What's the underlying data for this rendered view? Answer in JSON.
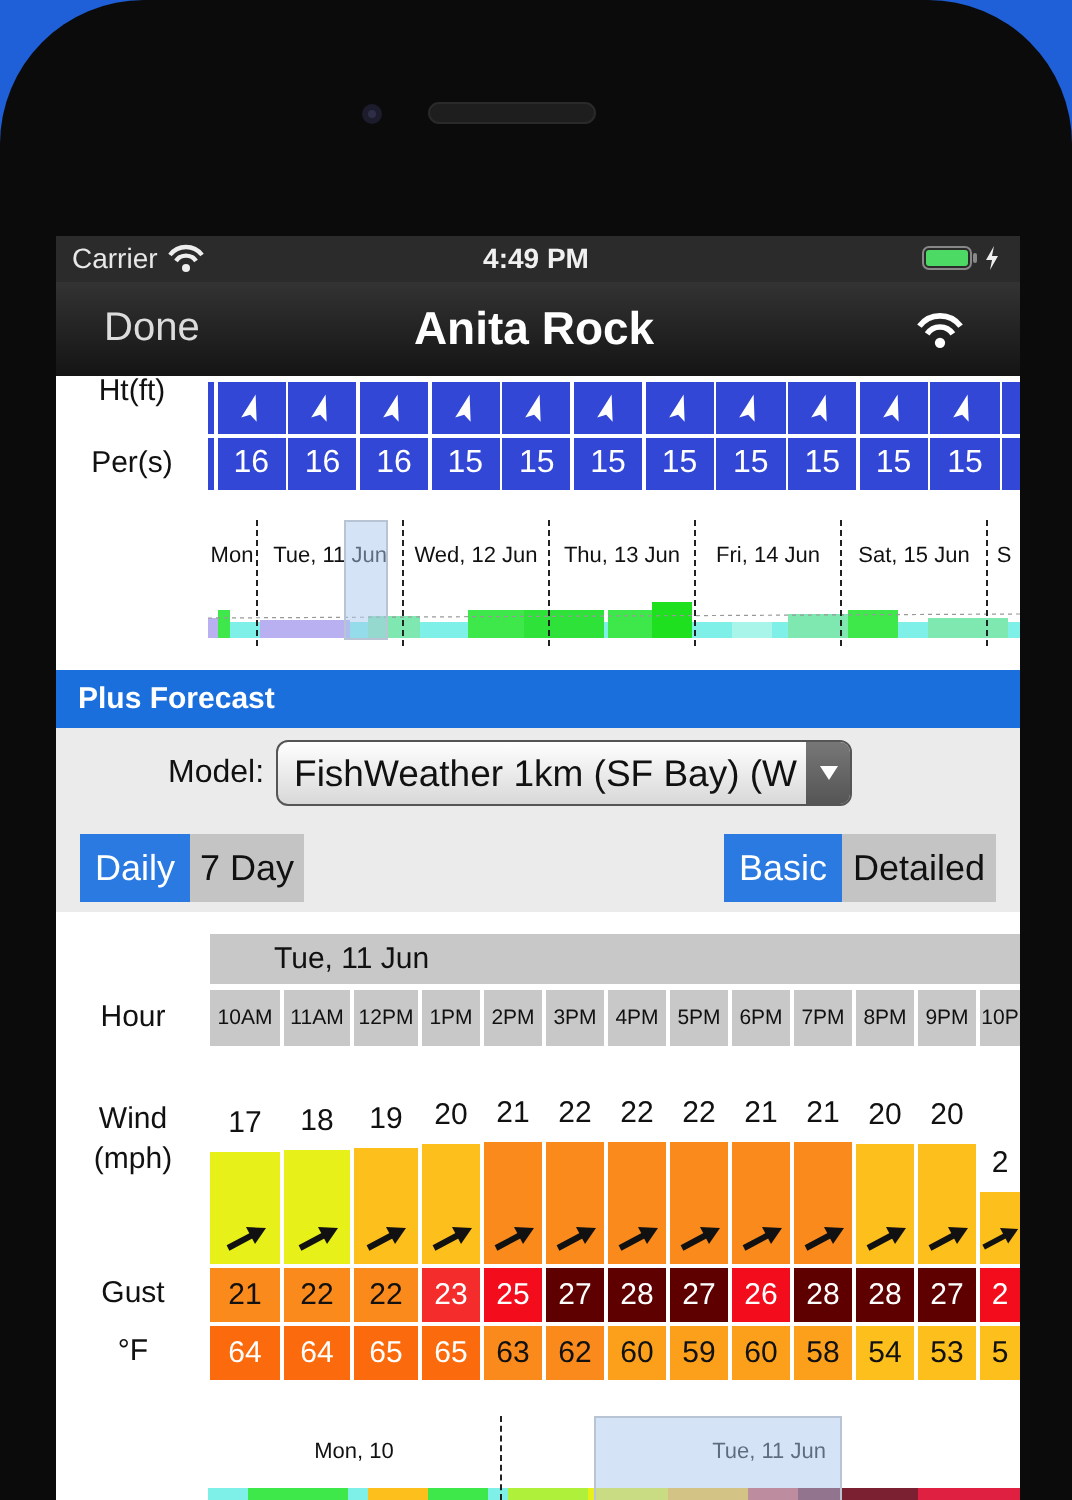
{
  "status_bar": {
    "carrier": "Carrier",
    "time": "4:49 PM"
  },
  "nav": {
    "back": "Done",
    "title": "Anita Rock"
  },
  "swell": {
    "ht_label": "Ht(ft)",
    "per_label": "Per(s)",
    "periods": [
      "16",
      "16",
      "16",
      "15",
      "15",
      "15",
      "15",
      "15",
      "15",
      "15",
      "15"
    ]
  },
  "overview": {
    "days": [
      "Mon",
      "Tue, 11 Jun",
      "Wed, 12 Jun",
      "Thu, 13 Jun",
      "Fri, 14 Jun",
      "Sat, 15 Jun",
      "S"
    ]
  },
  "section": {
    "title": "Plus Forecast"
  },
  "model": {
    "label": "Model:",
    "value": "FishWeather 1km (SF Bay) (W"
  },
  "range_tabs": [
    {
      "label": "Daily",
      "selected": true
    },
    {
      "label": "7 Day",
      "selected": false
    }
  ],
  "detail_tabs": [
    {
      "label": "Basic",
      "selected": true
    },
    {
      "label": "Detailed",
      "selected": false
    }
  ],
  "forecast": {
    "date": "Tue, 11 Jun",
    "hour_label": "Hour",
    "wind_label": "Wind (mph)",
    "gust_label": "Gust",
    "temp_label": "°F",
    "hours": [
      {
        "hour": "10AM",
        "wind": {
          "value": "17",
          "color": "#e8f01a"
        },
        "gust": {
          "value": "21",
          "color": "#fb8a1c"
        },
        "temp": {
          "value": "64",
          "color": "#fb6a0c"
        }
      },
      {
        "hour": "11AM",
        "wind": {
          "value": "18",
          "color": "#e8f01a"
        },
        "gust": {
          "value": "22",
          "color": "#fb8a1c"
        },
        "temp": {
          "value": "64",
          "color": "#fb6a0c"
        }
      },
      {
        "hour": "12PM",
        "wind": {
          "value": "19",
          "color": "#fdbf1c"
        },
        "gust": {
          "value": "22",
          "color": "#fb8a1c"
        },
        "temp": {
          "value": "65",
          "color": "#fb6a0c"
        }
      },
      {
        "hour": "1PM",
        "wind": {
          "value": "20",
          "color": "#fdbf1c"
        },
        "gust": {
          "value": "23",
          "color": "#f52c2c"
        },
        "temp": {
          "value": "65",
          "color": "#fb6a0c"
        }
      },
      {
        "hour": "2PM",
        "wind": {
          "value": "21",
          "color": "#fb8a1c"
        },
        "gust": {
          "value": "25",
          "color": "#f20c1c"
        },
        "temp": {
          "value": "63",
          "color": "#fb8a1c"
        }
      },
      {
        "hour": "3PM",
        "wind": {
          "value": "22",
          "color": "#fb8a1c"
        },
        "gust": {
          "value": "27",
          "color": "#5e0000"
        },
        "temp": {
          "value": "62",
          "color": "#fb8a1c"
        }
      },
      {
        "hour": "4PM",
        "wind": {
          "value": "22",
          "color": "#fb8a1c"
        },
        "gust": {
          "value": "28",
          "color": "#5e0000"
        },
        "temp": {
          "value": "60",
          "color": "#fca01c"
        }
      },
      {
        "hour": "5PM",
        "wind": {
          "value": "22",
          "color": "#fb8a1c"
        },
        "gust": {
          "value": "27",
          "color": "#5e0000"
        },
        "temp": {
          "value": "59",
          "color": "#fca01c"
        }
      },
      {
        "hour": "6PM",
        "wind": {
          "value": "21",
          "color": "#fb8a1c"
        },
        "gust": {
          "value": "26",
          "color": "#f20c1c"
        },
        "temp": {
          "value": "60",
          "color": "#fca01c"
        }
      },
      {
        "hour": "7PM",
        "wind": {
          "value": "21",
          "color": "#fb8a1c"
        },
        "gust": {
          "value": "28",
          "color": "#5e0000"
        },
        "temp": {
          "value": "58",
          "color": "#fca01c"
        }
      },
      {
        "hour": "8PM",
        "wind": {
          "value": "20",
          "color": "#fdbf1c"
        },
        "gust": {
          "value": "28",
          "color": "#5e0000"
        },
        "temp": {
          "value": "54",
          "color": "#fdbf1c"
        }
      },
      {
        "hour": "9PM",
        "wind": {
          "value": "20",
          "color": "#fdbf1c"
        },
        "gust": {
          "value": "27",
          "color": "#5e0000"
        },
        "temp": {
          "value": "53",
          "color": "#fdbf1c"
        }
      },
      {
        "hour": "10P",
        "wind": {
          "value": "2",
          "color": "#fdbf1c"
        },
        "gust": {
          "value": "2",
          "color": "#f20c1c"
        },
        "temp": {
          "value": "5",
          "color": "#fdbf1c"
        }
      }
    ]
  },
  "overview_bottom": {
    "days": [
      "Mon, 10",
      "Tue, 11 Jun"
    ]
  }
}
